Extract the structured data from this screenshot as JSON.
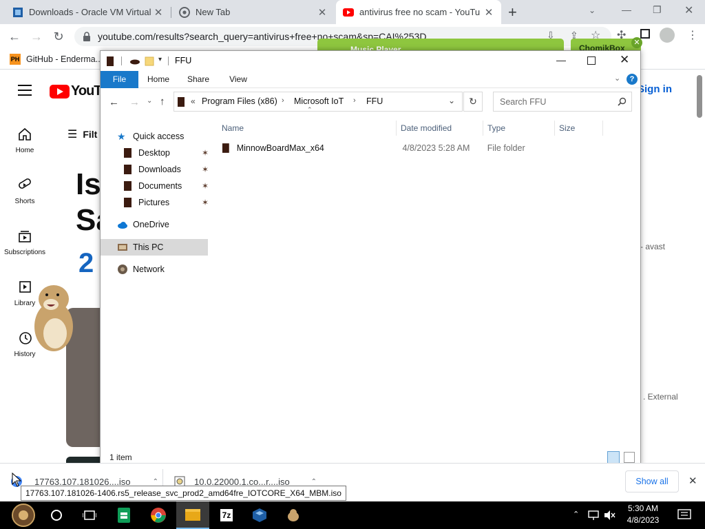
{
  "browser": {
    "tabs": [
      {
        "title": "Downloads - Oracle VM Virtual",
        "favicon": "virtualbox-icon"
      },
      {
        "title": "New Tab",
        "favicon": "chrome-icon"
      },
      {
        "title": "antivirus free no scam - YouTu",
        "favicon": "youtube-icon"
      }
    ],
    "new_tab": "+",
    "url": "youtube.com/results?search_query=antivirus+free+no+scam&sp=CAI%253D",
    "bookmark": "GitHub - Enderma...",
    "bookmark_badge": "PH"
  },
  "overlays": {
    "music_player": "Music Player",
    "chomikbox": "ChomikBox"
  },
  "youtube": {
    "logo": "YouTube",
    "sign_in": "Sign in",
    "filters": "Filt",
    "heading_line1": "Is",
    "heading_line2": "Sa",
    "heading_line3": "2",
    "right_text_1": "- avast",
    "right_text_2": ". External",
    "guide": [
      "Home",
      "Shorts",
      "Subscriptions",
      "Library",
      "History"
    ]
  },
  "explorer": {
    "title": "FFU",
    "ribbon_tabs": [
      "File",
      "Home",
      "Share",
      "View"
    ],
    "breadcrumb": [
      "Program Files (x86)",
      "Microsoft IoT",
      "FFU"
    ],
    "breadcrumb_prefix": "«",
    "search_placeholder": "Search FFU",
    "nav": {
      "quick_access": "Quick access",
      "pinned": [
        "Desktop",
        "Downloads",
        "Documents",
        "Pictures"
      ],
      "onedrive": "OneDrive",
      "this_pc": "This PC",
      "network": "Network"
    },
    "columns": [
      "Name",
      "Date modified",
      "Type",
      "Size"
    ],
    "files": [
      {
        "name": "MinnowBoardMax_x64",
        "date": "4/8/2023 5:28 AM",
        "type": "File folder",
        "size": ""
      }
    ],
    "status": "1 item"
  },
  "downloads": {
    "items": [
      {
        "name": "17763.107.181026....iso"
      },
      {
        "name": "10.0.22000.1.co...r....iso"
      }
    ],
    "tooltip": "17763.107.181026-1406.rs5_release_svc_prod2_amd64fre_IOTCORE_X64_MBM.iso",
    "show_all": "Show all"
  },
  "taskbar": {
    "time": "5:30 AM",
    "date": "4/8/2023",
    "app_7z": "7z"
  },
  "colors": {
    "accent": "#0063b1",
    "chrome_tabstrip": "#dee1e6",
    "youtube_red": "#ff0000",
    "folder_brown": "#3b1b10"
  }
}
